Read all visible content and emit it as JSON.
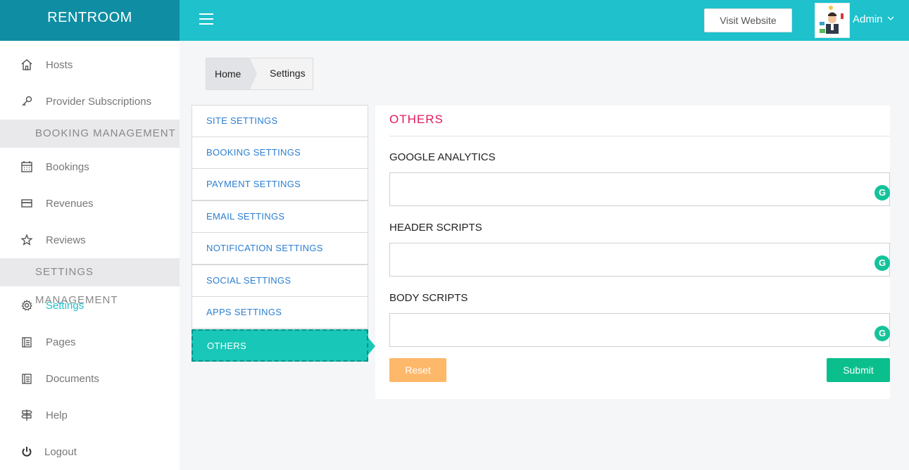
{
  "header": {
    "brand": "RENTROOM",
    "visit_label": "Visit Website",
    "user_name": "Admin"
  },
  "sidebar": {
    "items": [
      {
        "label": "Hosts",
        "icon": "home-icon"
      },
      {
        "label": "Provider Subscriptions",
        "icon": "key-icon"
      },
      {
        "section": "BOOKING MANAGEMENT"
      },
      {
        "label": "Bookings",
        "icon": "calendar-icon"
      },
      {
        "label": "Revenues",
        "icon": "credit-card-icon"
      },
      {
        "label": "Reviews",
        "icon": "star-icon"
      },
      {
        "section": "SETTINGS MANAGEMENT"
      },
      {
        "label": "Settings",
        "icon": "gear-icon",
        "active": true
      },
      {
        "label": "Pages",
        "icon": "book-icon"
      },
      {
        "label": "Documents",
        "icon": "book-icon"
      },
      {
        "label": "Help",
        "icon": "signpost-icon"
      },
      {
        "label": "Logout",
        "icon": "power-icon"
      }
    ]
  },
  "breadcrumb": {
    "home": "Home",
    "current": "Settings"
  },
  "tabs": [
    "SITE SETTINGS",
    "BOOKING SETTINGS",
    "PAYMENT SETTINGS",
    "EMAIL SETTINGS",
    "NOTIFICATION SETTINGS",
    "SOCIAL SETTINGS",
    "APPS SETTINGS",
    "OTHERS"
  ],
  "panel": {
    "title": "OTHERS",
    "fields": [
      {
        "label": "GOOGLE ANALYTICS",
        "value": ""
      },
      {
        "label": "HEADER SCRIPTS",
        "value": ""
      },
      {
        "label": "BODY SCRIPTS",
        "value": ""
      }
    ],
    "reset_label": "Reset",
    "submit_label": "Submit"
  },
  "colors": {
    "header": "#1ec1cc",
    "brand_bg": "#0f8ea3",
    "active_tab": "#18c7b7",
    "panel_title": "#e0195d",
    "reset": "#fdb86a",
    "submit": "#0bbf8d"
  }
}
